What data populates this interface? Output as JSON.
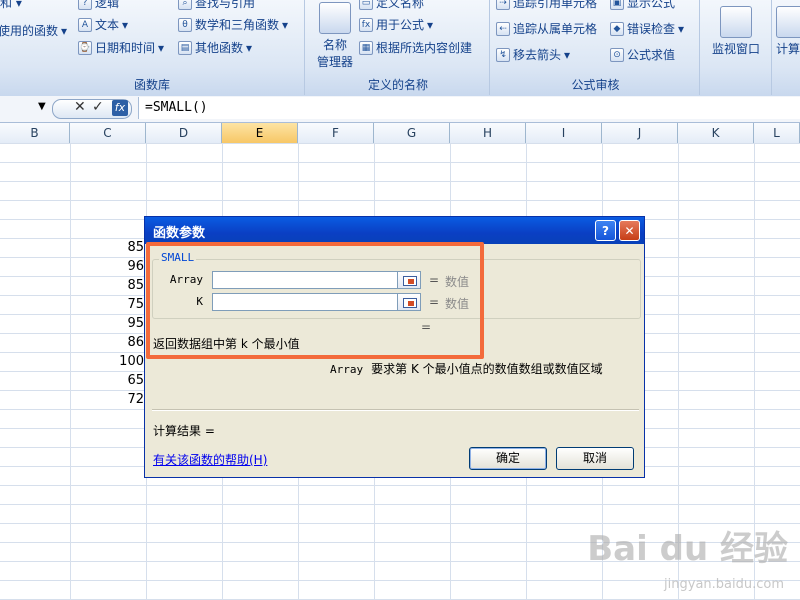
{
  "ribbon": {
    "groups": [
      {
        "title": "函数库",
        "items": [
          "使用的函数",
          "文本",
          "日期和时间",
          "逻辑",
          "查找与引用",
          "数学和三角函数",
          "其他函数"
        ]
      },
      {
        "title": "定义的名称",
        "big_label": "名称\n管理器",
        "items": [
          "定义名称",
          "用于公式",
          "根据所选内容创建"
        ]
      },
      {
        "title": "公式审核",
        "items": [
          "追踪引用单元格",
          "追踪从属单元格",
          "移去箭头",
          "显示公式",
          "错误检查",
          "公式求值"
        ]
      },
      {
        "big_label": "监视窗口"
      },
      {
        "big_label": "计算"
      }
    ]
  },
  "formula_bar": {
    "formula": "=SMALL()"
  },
  "sheet": {
    "columns": [
      "B",
      "C",
      "D",
      "E",
      "F",
      "G",
      "H",
      "I",
      "J",
      "K",
      "L"
    ],
    "selected_column": "E",
    "c_values": [
      "85",
      "96",
      "85",
      "75",
      "95",
      "86",
      "100",
      "65",
      "72"
    ]
  },
  "dialog": {
    "title": "函数参数",
    "help_button": "?",
    "close_button": "✕",
    "function_name": "SMALL",
    "args": [
      {
        "label": "Array",
        "value": "",
        "hint": "数值"
      },
      {
        "label": "K",
        "value": "",
        "hint": "数值"
      }
    ],
    "equals": "=",
    "description": "返回数据组中第 k 个最小值",
    "arg_desc_name": "Array",
    "arg_desc_text": "要求第 K 个最小值点的数值数组或数值区域",
    "result_label": "计算结果 =",
    "help_link": "有关该函数的帮助(H)",
    "ok": "确定",
    "cancel": "取消"
  },
  "watermark": {
    "brand": "Bai du 经验",
    "url": "jingyan.baidu.com"
  },
  "colors": {
    "highlight": "#f36a3b",
    "title_bar": "#0a5ce2",
    "selected_header": "#f7c766"
  }
}
